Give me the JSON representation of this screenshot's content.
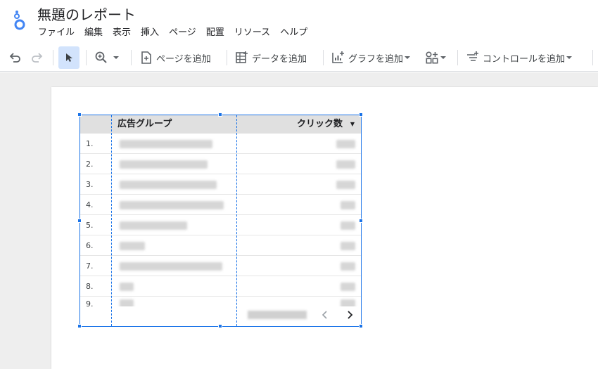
{
  "app": {
    "title": "無題のレポート",
    "menu": [
      "ファイル",
      "編集",
      "表示",
      "挿入",
      "ページ",
      "配置",
      "リソース",
      "ヘルプ"
    ]
  },
  "toolbar": {
    "add_page": "ページを追加",
    "add_data": "データを追加",
    "add_chart": "グラフを追加",
    "add_control": "コントロールを追加"
  },
  "table": {
    "header_dimension": "広告グループ",
    "header_metric": "クリック数",
    "row_numbers": [
      "1.",
      "2.",
      "3.",
      "4.",
      "5.",
      "6.",
      "7.",
      "8.",
      "9."
    ]
  },
  "colors": {
    "accent": "#1a73e8",
    "header_bg": "#e0e0e0",
    "canvas_bg": "#eeeeee"
  }
}
